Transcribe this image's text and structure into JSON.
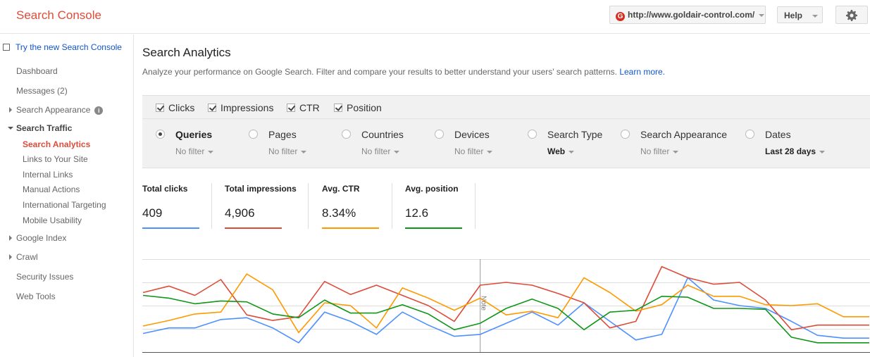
{
  "app": {
    "title": "Search Console"
  },
  "header": {
    "site_url": "http://www.goldair-control.com/",
    "help_label": "Help"
  },
  "sidebar": {
    "new_console_link": "Try the new Search Console",
    "items": [
      {
        "label": "Dashboard"
      },
      {
        "label": "Messages (2)"
      },
      {
        "label": "Search Appearance"
      },
      {
        "label": "Search Traffic"
      },
      {
        "label": "Search Analytics"
      },
      {
        "label": "Links to Your Site"
      },
      {
        "label": "Internal Links"
      },
      {
        "label": "Manual Actions"
      },
      {
        "label": "International Targeting"
      },
      {
        "label": "Mobile Usability"
      },
      {
        "label": "Google Index"
      },
      {
        "label": "Crawl"
      },
      {
        "label": "Security Issues"
      },
      {
        "label": "Web Tools"
      }
    ]
  },
  "main": {
    "title": "Search Analytics",
    "description": "Analyze your performance on Google Search. Filter and compare your results to better understand your users' search patterns.",
    "learn_more": "Learn more.",
    "metrics": [
      {
        "label": "Clicks",
        "checked": true
      },
      {
        "label": "Impressions",
        "checked": true
      },
      {
        "label": "CTR",
        "checked": true
      },
      {
        "label": "Position",
        "checked": true
      }
    ],
    "dimensions": [
      {
        "label": "Queries",
        "sub": "No filter",
        "selected": true
      },
      {
        "label": "Pages",
        "sub": "No filter",
        "selected": false
      },
      {
        "label": "Countries",
        "sub": "No filter",
        "selected": false
      },
      {
        "label": "Devices",
        "sub": "No filter",
        "selected": false
      },
      {
        "label": "Search Type",
        "sub": "Web",
        "selected": false
      },
      {
        "label": "Search Appearance",
        "sub": "No filter",
        "selected": false
      },
      {
        "label": "Dates",
        "sub": "Last 28 days",
        "selected": false
      }
    ],
    "kpis": [
      {
        "label": "Total clicks",
        "value": "409",
        "color": "#4d90fe"
      },
      {
        "label": "Total impressions",
        "value": "4,906",
        "color": "#dd4b39"
      },
      {
        "label": "Avg. CTR",
        "value": "8.34%",
        "color": "#ff9900"
      },
      {
        "label": "Avg. position",
        "value": "12.6",
        "color": "#109618"
      }
    ]
  },
  "chart_data": {
    "type": "line",
    "x": [
      1,
      2,
      3,
      4,
      5,
      6,
      7,
      8,
      9,
      10,
      11,
      12,
      13,
      14,
      15,
      16,
      17,
      18,
      19,
      20,
      21,
      22,
      23,
      24,
      25,
      26,
      27,
      28,
      29
    ],
    "annotation": "Note",
    "grid": true,
    "series": [
      {
        "color": "#4d90fe",
        "values": [
          0.2,
          0.26,
          0.26,
          0.35,
          0.37,
          0.26,
          0.1,
          0.43,
          0.33,
          0.19,
          0.43,
          0.29,
          0.17,
          0.19,
          0.31,
          0.43,
          0.29,
          0.53,
          0.33,
          0.13,
          0.19,
          0.8,
          0.56,
          0.5,
          0.47,
          0.33,
          0.18,
          0.15,
          0.15
        ]
      },
      {
        "color": "#dd4b39",
        "values": [
          0.64,
          0.71,
          0.61,
          0.78,
          0.4,
          0.34,
          0.38,
          0.76,
          0.62,
          0.72,
          0.61,
          0.5,
          0.33,
          0.72,
          0.75,
          0.72,
          0.63,
          0.53,
          0.26,
          0.33,
          0.92,
          0.8,
          0.73,
          0.75,
          0.56,
          0.24,
          0.29,
          0.29,
          0.29
        ]
      },
      {
        "color": "#ff9900",
        "values": [
          0.28,
          0.34,
          0.41,
          0.43,
          0.84,
          0.67,
          0.21,
          0.53,
          0.5,
          0.26,
          0.69,
          0.58,
          0.45,
          0.58,
          0.4,
          0.44,
          0.37,
          0.8,
          0.64,
          0.44,
          0.51,
          0.72,
          0.6,
          0.6,
          0.51,
          0.5,
          0.52,
          0.38,
          0.38
        ]
      },
      {
        "color": "#109618",
        "values": [
          0.61,
          0.58,
          0.52,
          0.55,
          0.54,
          0.41,
          0.37,
          0.56,
          0.42,
          0.42,
          0.51,
          0.41,
          0.24,
          0.31,
          0.47,
          0.57,
          0.47,
          0.24,
          0.43,
          0.45,
          0.6,
          0.59,
          0.47,
          0.47,
          0.46,
          0.16,
          0.1,
          0.1,
          0.1
        ]
      }
    ]
  }
}
